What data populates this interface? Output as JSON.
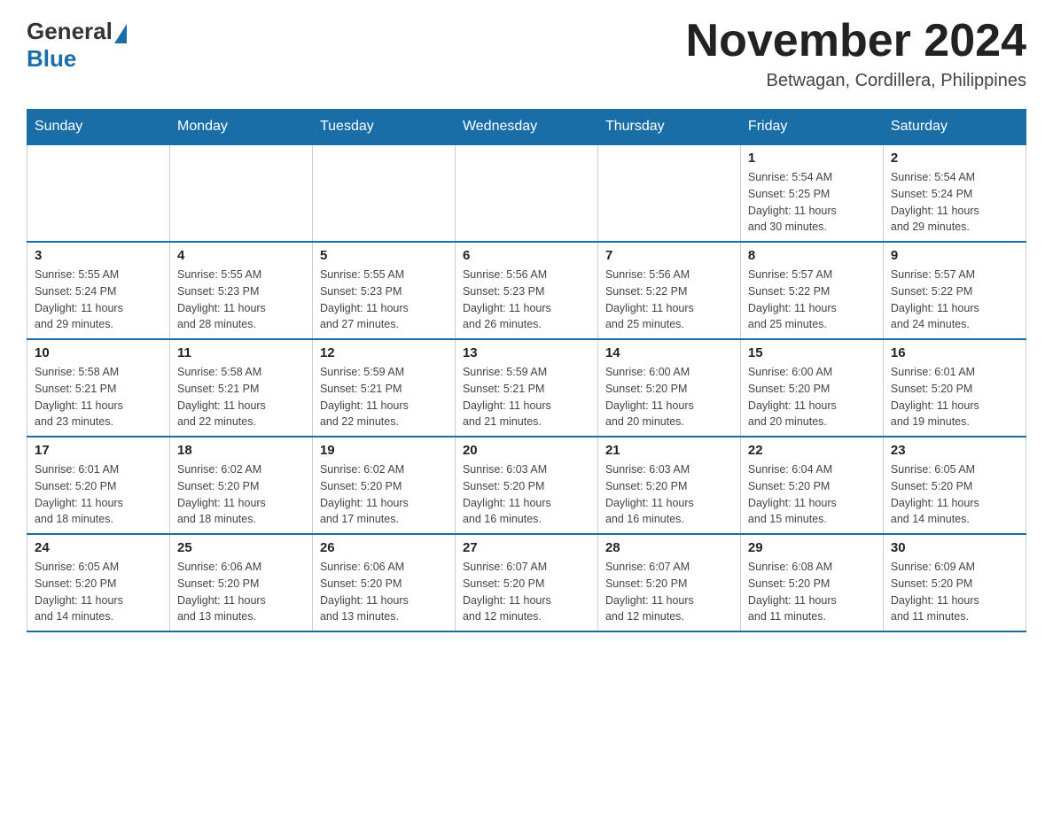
{
  "logo": {
    "text_general": "General",
    "text_blue": "Blue"
  },
  "header": {
    "month_year": "November 2024",
    "location": "Betwagan, Cordillera, Philippines"
  },
  "weekdays": [
    "Sunday",
    "Monday",
    "Tuesday",
    "Wednesday",
    "Thursday",
    "Friday",
    "Saturday"
  ],
  "weeks": [
    [
      {
        "day": "",
        "info": ""
      },
      {
        "day": "",
        "info": ""
      },
      {
        "day": "",
        "info": ""
      },
      {
        "day": "",
        "info": ""
      },
      {
        "day": "",
        "info": ""
      },
      {
        "day": "1",
        "info": "Sunrise: 5:54 AM\nSunset: 5:25 PM\nDaylight: 11 hours\nand 30 minutes."
      },
      {
        "day": "2",
        "info": "Sunrise: 5:54 AM\nSunset: 5:24 PM\nDaylight: 11 hours\nand 29 minutes."
      }
    ],
    [
      {
        "day": "3",
        "info": "Sunrise: 5:55 AM\nSunset: 5:24 PM\nDaylight: 11 hours\nand 29 minutes."
      },
      {
        "day": "4",
        "info": "Sunrise: 5:55 AM\nSunset: 5:23 PM\nDaylight: 11 hours\nand 28 minutes."
      },
      {
        "day": "5",
        "info": "Sunrise: 5:55 AM\nSunset: 5:23 PM\nDaylight: 11 hours\nand 27 minutes."
      },
      {
        "day": "6",
        "info": "Sunrise: 5:56 AM\nSunset: 5:23 PM\nDaylight: 11 hours\nand 26 minutes."
      },
      {
        "day": "7",
        "info": "Sunrise: 5:56 AM\nSunset: 5:22 PM\nDaylight: 11 hours\nand 25 minutes."
      },
      {
        "day": "8",
        "info": "Sunrise: 5:57 AM\nSunset: 5:22 PM\nDaylight: 11 hours\nand 25 minutes."
      },
      {
        "day": "9",
        "info": "Sunrise: 5:57 AM\nSunset: 5:22 PM\nDaylight: 11 hours\nand 24 minutes."
      }
    ],
    [
      {
        "day": "10",
        "info": "Sunrise: 5:58 AM\nSunset: 5:21 PM\nDaylight: 11 hours\nand 23 minutes."
      },
      {
        "day": "11",
        "info": "Sunrise: 5:58 AM\nSunset: 5:21 PM\nDaylight: 11 hours\nand 22 minutes."
      },
      {
        "day": "12",
        "info": "Sunrise: 5:59 AM\nSunset: 5:21 PM\nDaylight: 11 hours\nand 22 minutes."
      },
      {
        "day": "13",
        "info": "Sunrise: 5:59 AM\nSunset: 5:21 PM\nDaylight: 11 hours\nand 21 minutes."
      },
      {
        "day": "14",
        "info": "Sunrise: 6:00 AM\nSunset: 5:20 PM\nDaylight: 11 hours\nand 20 minutes."
      },
      {
        "day": "15",
        "info": "Sunrise: 6:00 AM\nSunset: 5:20 PM\nDaylight: 11 hours\nand 20 minutes."
      },
      {
        "day": "16",
        "info": "Sunrise: 6:01 AM\nSunset: 5:20 PM\nDaylight: 11 hours\nand 19 minutes."
      }
    ],
    [
      {
        "day": "17",
        "info": "Sunrise: 6:01 AM\nSunset: 5:20 PM\nDaylight: 11 hours\nand 18 minutes."
      },
      {
        "day": "18",
        "info": "Sunrise: 6:02 AM\nSunset: 5:20 PM\nDaylight: 11 hours\nand 18 minutes."
      },
      {
        "day": "19",
        "info": "Sunrise: 6:02 AM\nSunset: 5:20 PM\nDaylight: 11 hours\nand 17 minutes."
      },
      {
        "day": "20",
        "info": "Sunrise: 6:03 AM\nSunset: 5:20 PM\nDaylight: 11 hours\nand 16 minutes."
      },
      {
        "day": "21",
        "info": "Sunrise: 6:03 AM\nSunset: 5:20 PM\nDaylight: 11 hours\nand 16 minutes."
      },
      {
        "day": "22",
        "info": "Sunrise: 6:04 AM\nSunset: 5:20 PM\nDaylight: 11 hours\nand 15 minutes."
      },
      {
        "day": "23",
        "info": "Sunrise: 6:05 AM\nSunset: 5:20 PM\nDaylight: 11 hours\nand 14 minutes."
      }
    ],
    [
      {
        "day": "24",
        "info": "Sunrise: 6:05 AM\nSunset: 5:20 PM\nDaylight: 11 hours\nand 14 minutes."
      },
      {
        "day": "25",
        "info": "Sunrise: 6:06 AM\nSunset: 5:20 PM\nDaylight: 11 hours\nand 13 minutes."
      },
      {
        "day": "26",
        "info": "Sunrise: 6:06 AM\nSunset: 5:20 PM\nDaylight: 11 hours\nand 13 minutes."
      },
      {
        "day": "27",
        "info": "Sunrise: 6:07 AM\nSunset: 5:20 PM\nDaylight: 11 hours\nand 12 minutes."
      },
      {
        "day": "28",
        "info": "Sunrise: 6:07 AM\nSunset: 5:20 PM\nDaylight: 11 hours\nand 12 minutes."
      },
      {
        "day": "29",
        "info": "Sunrise: 6:08 AM\nSunset: 5:20 PM\nDaylight: 11 hours\nand 11 minutes."
      },
      {
        "day": "30",
        "info": "Sunrise: 6:09 AM\nSunset: 5:20 PM\nDaylight: 11 hours\nand 11 minutes."
      }
    ]
  ]
}
